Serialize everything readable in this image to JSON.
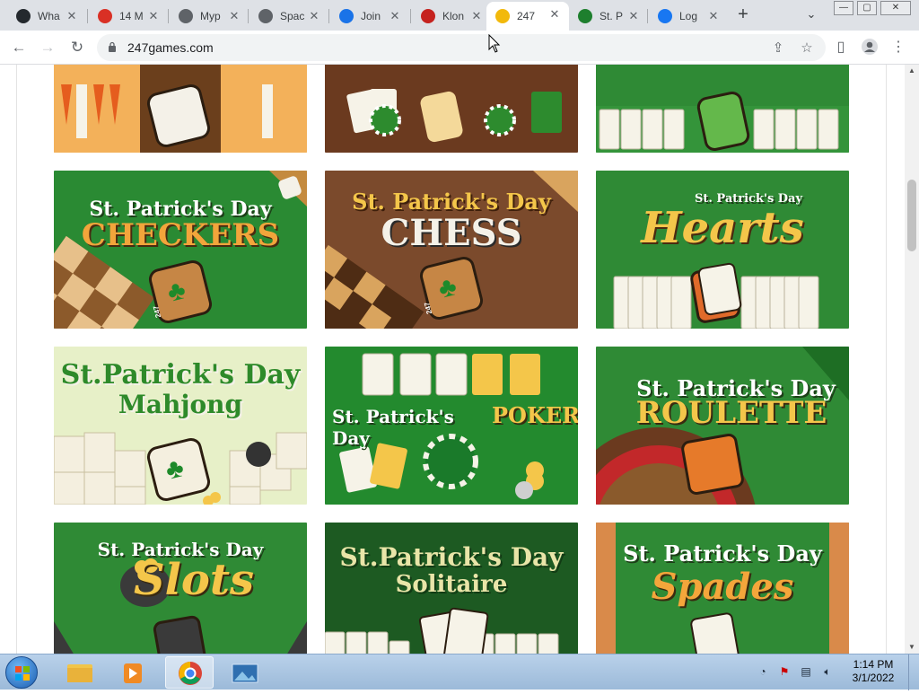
{
  "browser": {
    "tabs": [
      {
        "title": "Wha",
        "favicon": "github-icon",
        "color": "#24292e",
        "active": false
      },
      {
        "title": "14 M",
        "favicon": "target-icon",
        "color": "#d93025",
        "active": false
      },
      {
        "title": "Myp",
        "favicon": "globe-icon",
        "color": "#5f6368",
        "active": false
      },
      {
        "title": "Spac",
        "favicon": "globe-icon",
        "color": "#5f6368",
        "active": false
      },
      {
        "title": "Join",
        "favicon": "s-icon",
        "color": "#1a73e8",
        "active": false
      },
      {
        "title": "Klon",
        "favicon": "puzzle-icon",
        "color": "#c5221f",
        "active": false
      },
      {
        "title": "247",
        "favicon": "247-icon",
        "color": "#f2b90c",
        "active": true
      },
      {
        "title": "St. P",
        "favicon": "clover-icon",
        "color": "#1e7f2e",
        "active": false
      },
      {
        "title": "Log",
        "favicon": "facebook-icon",
        "color": "#1877f2",
        "active": false
      }
    ],
    "url": "247games.com",
    "window_controls": {
      "minimize": "—",
      "maximize": "▢",
      "close": "✕"
    }
  },
  "games": [
    {
      "row": 0,
      "title_line1": "",
      "title_line2": "",
      "bg": "#e89b3a",
      "kind": "backgammon"
    },
    {
      "row": 0,
      "title_line1": "",
      "title_line2": "",
      "bg": "#6b3a1f",
      "kind": "poker-top"
    },
    {
      "row": 0,
      "title_line1": "",
      "title_line2": "",
      "bg": "#2f8a35",
      "kind": "cards-top"
    },
    {
      "row": 1,
      "title_line1": "St. Patrick's Day",
      "title_line2": "CHECKERS",
      "bg": "#2a8a33",
      "title2_color": "#f2a53b"
    },
    {
      "row": 1,
      "title_line1": "St. Patrick's Day",
      "title_line2": "CHESS",
      "bg": "#7b4a2c",
      "title2_color": "#f4f1e8"
    },
    {
      "row": 1,
      "title_line1": "St. Patrick's Day",
      "title_line2": "Hearts",
      "bg": "#2f8a35",
      "title2_color": "#f4c64a"
    },
    {
      "row": 2,
      "title_line1": "St.Patrick's Day",
      "title_line2": "Mahjong",
      "bg": "#e7f0c8",
      "title2_color": "#2e8a2a"
    },
    {
      "row": 2,
      "title_line1": "St. Patrick's Day",
      "title_line2": "POKER",
      "bg": "#238a2e",
      "title2_color": "#f4c64a"
    },
    {
      "row": 2,
      "title_line1": "St. Patrick's Day",
      "title_line2": "ROULETTE",
      "bg": "#2f8a35",
      "title2_color": "#f4c64a"
    },
    {
      "row": 3,
      "title_line1": "St. Patrick's Day",
      "title_line2": "Slots",
      "bg": "#2f8a35",
      "title2_color": "#f4c64a"
    },
    {
      "row": 3,
      "title_line1": "St.Patrick's Day",
      "title_line2": "Solitaire",
      "bg": "#1d5a22",
      "title2_color": "#e9e5a8"
    },
    {
      "row": 3,
      "title_line1": "St. Patrick's Day",
      "title_line2": "Spades",
      "bg": "#2f8a35",
      "title2_color": "#f4a63b"
    }
  ],
  "badge_text": "247",
  "taskbar": {
    "apps": [
      "explorer-icon",
      "media-player-icon",
      "chrome-icon",
      "image-viewer-icon"
    ],
    "time": "1:14 PM",
    "date": "3/1/2022"
  }
}
